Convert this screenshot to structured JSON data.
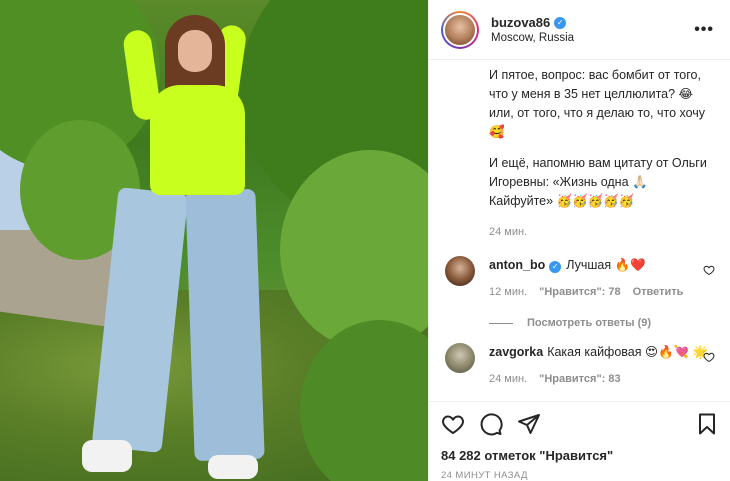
{
  "header": {
    "username": "buzova86",
    "location": "Moscow, Russia",
    "more_label": "•••"
  },
  "caption": {
    "paragraph1": "И пятое, вопрос: вас бомбит от того, что у меня в 35 нет целлюлита? 😂 или, от того, что я делаю то, что хочу 🥰",
    "paragraph2": "И ещё, напомню вам цитату от Ольги Игоревны: «Жизнь одна 🙏🏻 Кайфуйте» 🥳🥳🥳🥳🥳",
    "time": "24 мин."
  },
  "comments": [
    {
      "user": "anton_bo",
      "verified": true,
      "text": "Лучшая 🔥❤️",
      "time": "12 мин.",
      "likes": "\"Нравится\": 78",
      "reply_label": "Ответить"
    },
    {
      "user": "zavgorka",
      "verified": false,
      "text": "Какая кайфовая 😍🔥💘 🌟",
      "time": "24 мин.",
      "likes": "\"Нравится\": 83"
    }
  ],
  "replies": {
    "label": "Посмотреть ответы (9)"
  },
  "actions": {
    "likes_count": "84 282 отметок \"Нравится\"",
    "date": "24 МИНУТ НАЗАД"
  },
  "icons": [
    "heart-icon",
    "comment-icon",
    "share-icon",
    "bookmark-icon",
    "verified-badge-icon",
    "more-options-icon"
  ],
  "colors": {
    "verified": "#3897f0",
    "muted": "#8e8e8e",
    "border": "#efefef",
    "top_neon": "#c8ff1e"
  }
}
